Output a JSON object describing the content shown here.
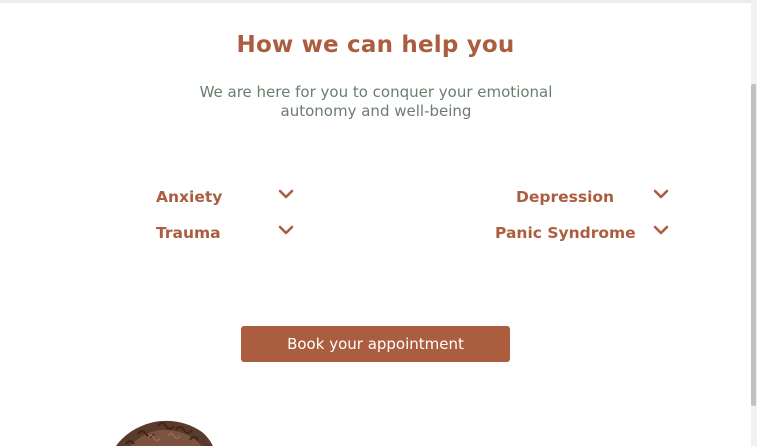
{
  "header": {
    "title": "How we can help you",
    "subtitle": "We are here for you to conquer your emotional autonomy and well-being"
  },
  "services": [
    {
      "label": "Anxiety",
      "icon": "chevron-down-icon"
    },
    {
      "label": "Depression",
      "icon": "chevron-down-icon"
    },
    {
      "label": "Trauma",
      "icon": "chevron-down-icon"
    },
    {
      "label": "Panic Syndrome",
      "icon": "chevron-down-icon"
    }
  ],
  "cta": {
    "label": "Book your appointment"
  },
  "colors": {
    "accent": "#ab5e3f",
    "subtitle": "#6b7d6d",
    "background": "#ffffff"
  }
}
